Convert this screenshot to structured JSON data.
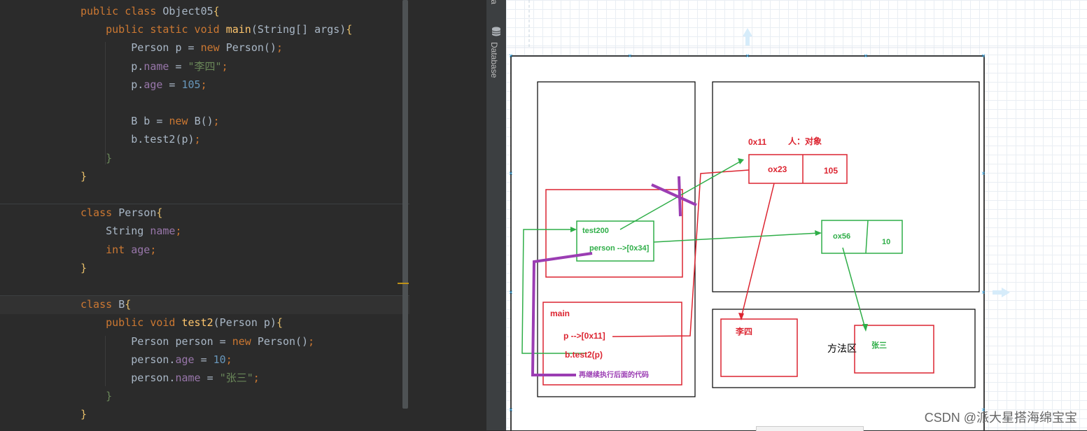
{
  "code": {
    "lines": [
      [
        {
          "t": "public class ",
          "c": "kw"
        },
        {
          "t": "Object05",
          "c": ""
        },
        {
          "t": "{",
          "c": "br"
        }
      ],
      [
        {
          "t": "    "
        },
        {
          "t": "public static void ",
          "c": "kw"
        },
        {
          "t": "main",
          "c": "fn"
        },
        {
          "t": "(String[] args)"
        },
        {
          "t": "{",
          "c": "br"
        }
      ],
      [
        {
          "t": "        Person p = "
        },
        {
          "t": "new ",
          "c": "kw"
        },
        {
          "t": "Person()"
        },
        {
          "t": ";",
          "c": "kw"
        }
      ],
      [
        {
          "t": "        p."
        },
        {
          "t": "name",
          "c": "fd"
        },
        {
          "t": " = "
        },
        {
          "t": "\"李四\"",
          "c": "st"
        },
        {
          "t": ";",
          "c": "kw"
        }
      ],
      [
        {
          "t": "        p."
        },
        {
          "t": "age",
          "c": "fd"
        },
        {
          "t": " = "
        },
        {
          "t": "105",
          "c": "nm"
        },
        {
          "t": ";",
          "c": "kw"
        }
      ],
      [],
      [
        {
          "t": "        B b = "
        },
        {
          "t": "new ",
          "c": "kw"
        },
        {
          "t": "B()"
        },
        {
          "t": ";",
          "c": "kw"
        }
      ],
      [
        {
          "t": "        b.test2(p)"
        },
        {
          "t": ";",
          "c": "kw"
        }
      ],
      [
        {
          "t": "    "
        },
        {
          "t": "}",
          "c": "st"
        }
      ],
      [
        {
          "t": "}",
          "c": "br"
        }
      ],
      [],
      [
        {
          "t": "class ",
          "c": "kw"
        },
        {
          "t": "Person"
        },
        {
          "t": "{",
          "c": "br"
        }
      ],
      [
        {
          "t": "    String "
        },
        {
          "t": "name",
          "c": "fd"
        },
        {
          "t": ";",
          "c": "kw"
        }
      ],
      [
        {
          "t": "    "
        },
        {
          "t": "int ",
          "c": "kw"
        },
        {
          "t": "age",
          "c": "fd"
        },
        {
          "t": ";",
          "c": "kw"
        }
      ],
      [
        {
          "t": "}",
          "c": "br"
        }
      ],
      [],
      [
        {
          "t": "class ",
          "c": "kw"
        },
        {
          "t": "B"
        },
        {
          "t": "{",
          "c": "br"
        }
      ],
      [
        {
          "t": "    "
        },
        {
          "t": "public void ",
          "c": "kw"
        },
        {
          "t": "test2",
          "c": "fn"
        },
        {
          "t": "(Person p)"
        },
        {
          "t": "{",
          "c": "br"
        }
      ],
      [
        {
          "t": "        Person person = "
        },
        {
          "t": "new ",
          "c": "kw"
        },
        {
          "t": "Person()"
        },
        {
          "t": ";",
          "c": "kw"
        }
      ],
      [
        {
          "t": "        person."
        },
        {
          "t": "age",
          "c": "fd"
        },
        {
          "t": " = "
        },
        {
          "t": "10",
          "c": "nm"
        },
        {
          "t": ";",
          "c": "kw"
        }
      ],
      [
        {
          "t": "        person."
        },
        {
          "t": "name",
          "c": "fd"
        },
        {
          "t": " = "
        },
        {
          "t": "\"张三\"",
          "c": "st"
        },
        {
          "t": ";",
          "c": "kw"
        }
      ],
      [
        {
          "t": "    "
        },
        {
          "t": "}",
          "c": "st"
        }
      ],
      [
        {
          "t": "}",
          "c": "br"
        }
      ]
    ]
  },
  "tool_window": {
    "top_label": "ta",
    "database_label": "Database"
  },
  "diagram": {
    "addr_0x11": "0x11",
    "obj_label": "人：对象",
    "obj_ox23": "ox23",
    "obj_105": "105",
    "test200": "test200",
    "person_ref": "person -->[0x34]",
    "obj_ox56": "ox56",
    "obj_10": "10",
    "main_label": "main",
    "p_ref": "p -->[0x11]",
    "call": "b.test2(p)",
    "continue_note": "再继续执行后面的代码",
    "str_lisi": "李四",
    "method_area": "方法区",
    "str_zhangsan": "张三"
  },
  "colors": {
    "red": "#dc2430",
    "green": "#2fae48",
    "purple": "#9b3db3"
  },
  "watermark": "CSDN @派大星搭海绵宝宝"
}
